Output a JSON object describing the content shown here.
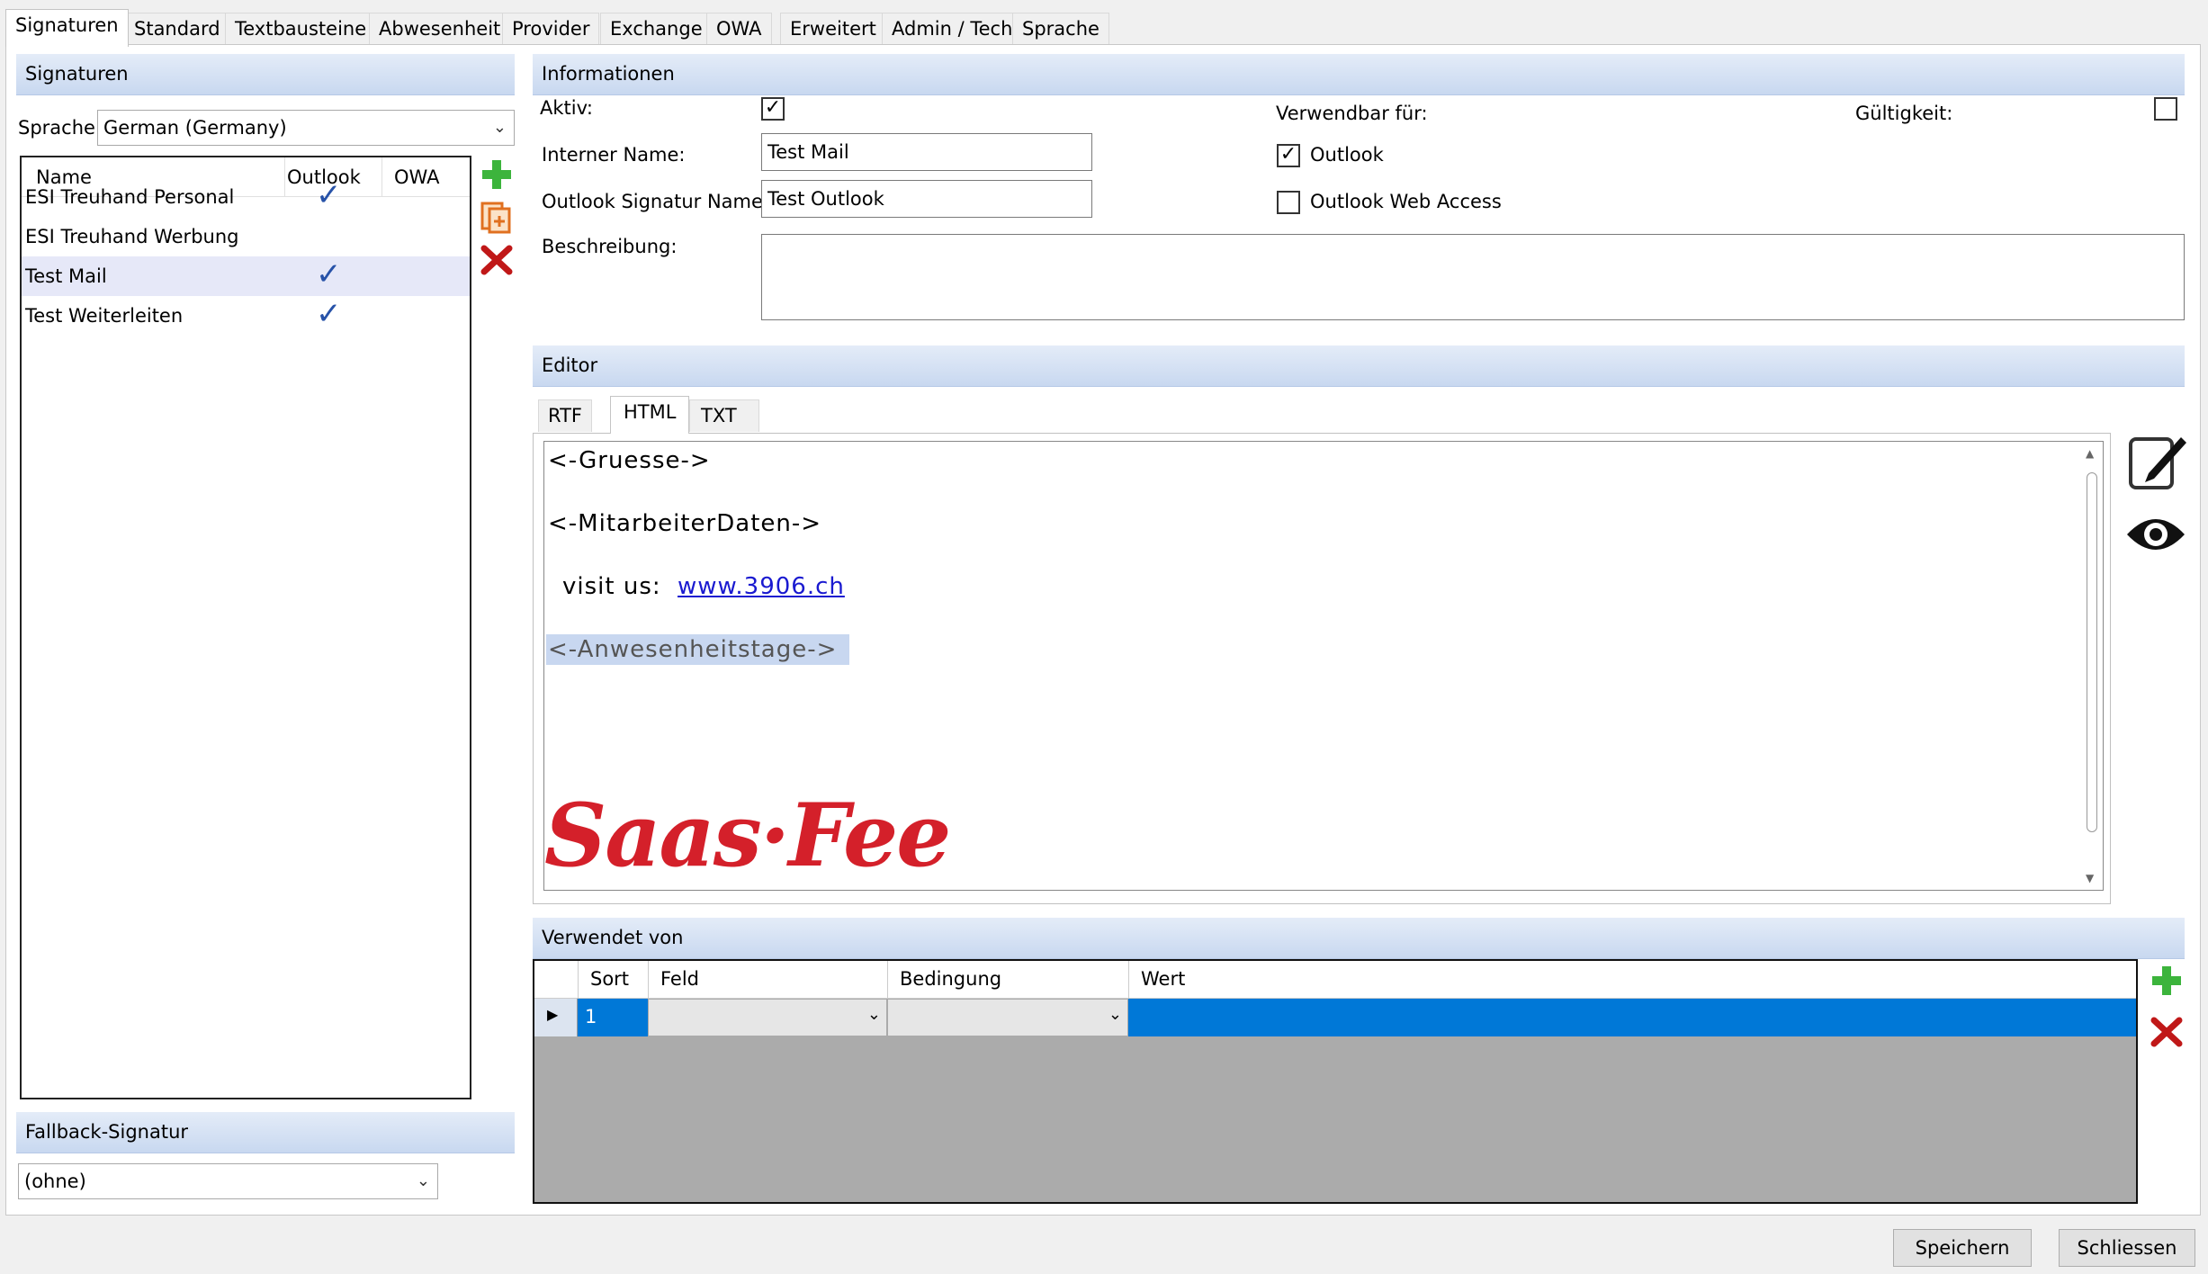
{
  "tabs": [
    "Signaturen",
    "Standard",
    "Textbausteine",
    "Abwesenheit",
    "Provider",
    "Exchange",
    "OWA",
    "Erweitert",
    "Admin / Tech",
    "Sprache"
  ],
  "signaturen": {
    "header": "Signaturen",
    "sprache_label": "Sprache",
    "sprache_value": "German (Germany)",
    "columns": [
      "Name",
      "Outlook",
      "OWA"
    ],
    "rows": [
      {
        "name": "ESI Treuhand Personal",
        "outlook": "✓"
      },
      {
        "name": "ESI Treuhand Werbung",
        "outlook": ""
      },
      {
        "name": "Test Mail",
        "outlook": "✓"
      },
      {
        "name": "Test Weiterleiten",
        "outlook": "✓"
      }
    ],
    "fallback_header": "Fallback-Signatur",
    "fallback_value": "(ohne)"
  },
  "informationen": {
    "header": "Informationen",
    "aktiv_label": "Aktiv:",
    "aktiv_checked": "✓",
    "interner_name_label": "Interner Name:",
    "interner_name_value": "Test Mail",
    "outlook_sig_label": "Outlook Signatur Name:",
    "outlook_sig_value": "Test Outlook",
    "beschreibung_label": "Beschreibung:",
    "verwendbar_label": "Verwendbar für:",
    "outlook_label": "Outlook",
    "outlook_checked": "✓",
    "owa_label": "Outlook Web Access",
    "gueltigkeit_label": "Gültigkeit:"
  },
  "editor": {
    "header": "Editor",
    "tabs": [
      "RTF",
      "HTML",
      "TXT"
    ],
    "lines": {
      "gruesse": "<-Gruesse->",
      "mitarbeiter": "<-MitarbeiterDaten->",
      "visit": "visit us:",
      "link": "www.3906.ch",
      "anwesenheit": "<-Anwesenheitstage->"
    },
    "logo_text": "Saas·Fee"
  },
  "verwendet": {
    "header": "Verwendet von",
    "columns": [
      "Sort",
      "Feld",
      "Bedingung",
      "Wert"
    ],
    "row_sort": "1"
  },
  "buttons": {
    "save": "Speichern",
    "close": "Schliessen"
  },
  "colors": {
    "accent": "#0078d7",
    "logo": "#d4202a",
    "add": "#3cb43c",
    "delete": "#c01818"
  }
}
